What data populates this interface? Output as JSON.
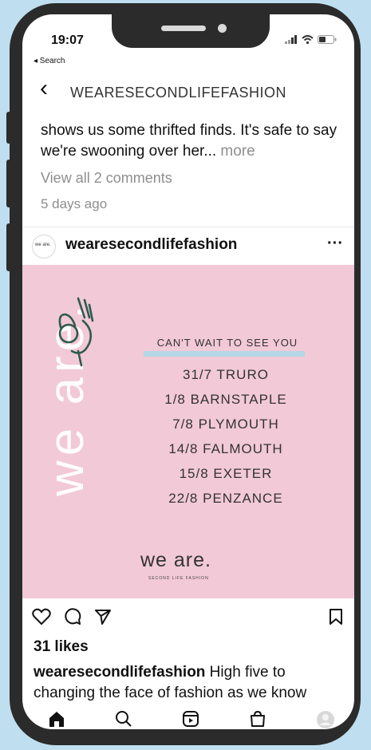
{
  "status_bar": {
    "time": "19:07",
    "back_app": "◂ Search"
  },
  "header": {
    "title": "WEARESECONDLIFEFASHION"
  },
  "prev_post": {
    "caption": "shows us some thrifted finds. It's safe to say we're swooning over her...",
    "more": "more",
    "view_comments": "View all 2 comments",
    "time_ago": "5 days ago"
  },
  "post": {
    "avatar_text": "we are.",
    "username": "wearesecondlifefashion",
    "image": {
      "vertical_text": "we are.",
      "headline": "CAN'T WAIT TO SEE YOU",
      "dates": [
        "31/7  TRURO",
        "1/8  BARNSTAPLE",
        "7/8  PLYMOUTH",
        "14/8  FALMOUTH",
        "15/8  EXETER",
        "22/8  PENZANCE"
      ],
      "brand": "we are.",
      "brand_sub": "SECOND LIFE FASHION",
      "accent_colors": {
        "background": "#f2c9d6",
        "bar": "#b5d7e6"
      }
    },
    "likes": "31 likes",
    "caption_user": "wearesecondlifefashion",
    "caption_text": " High five to changing the face of fashion as we know"
  },
  "tabbar": {
    "icons": [
      "home-icon",
      "search-icon",
      "reels-icon",
      "shop-icon",
      "profile-icon"
    ]
  }
}
